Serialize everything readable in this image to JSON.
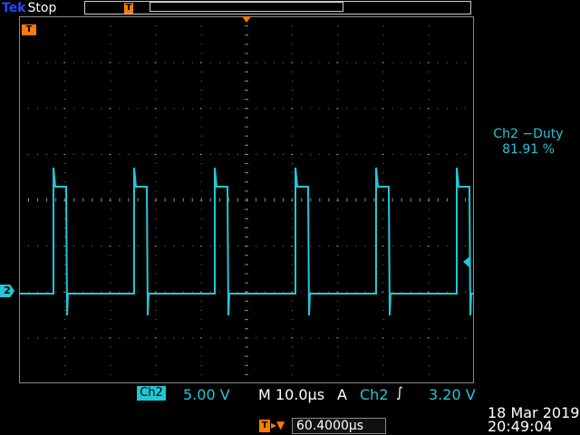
{
  "header": {
    "brand": "Tek",
    "status": "Stop",
    "trigger_position_marker": "T"
  },
  "markers": {
    "trigger_level_marker": "T",
    "ch2_ground_marker": "2"
  },
  "measurement": {
    "label": "Ch2 −Duty",
    "value": "81.91 %"
  },
  "readout": {
    "channel_badge": "Ch2",
    "channel_scale": "5.00 V",
    "timebase": "M 10.0µs",
    "trigger_mode": "A",
    "trigger_source": "Ch2",
    "trigger_slope": "∫",
    "trigger_level": "3.20 V",
    "trigger_delay_icon": "T",
    "trigger_delay_arrow": "▸▼",
    "trigger_delay": "60.4000µs",
    "date": "18 Mar  2019",
    "time": "20:49:04"
  },
  "colors": {
    "ch2": "#22c7d7",
    "trigger": "#ff7a00",
    "brand": "#2a47ff"
  },
  "waveform": {
    "channel": "Ch2",
    "duty_percent": 81.91,
    "pulse_count": 6
  }
}
